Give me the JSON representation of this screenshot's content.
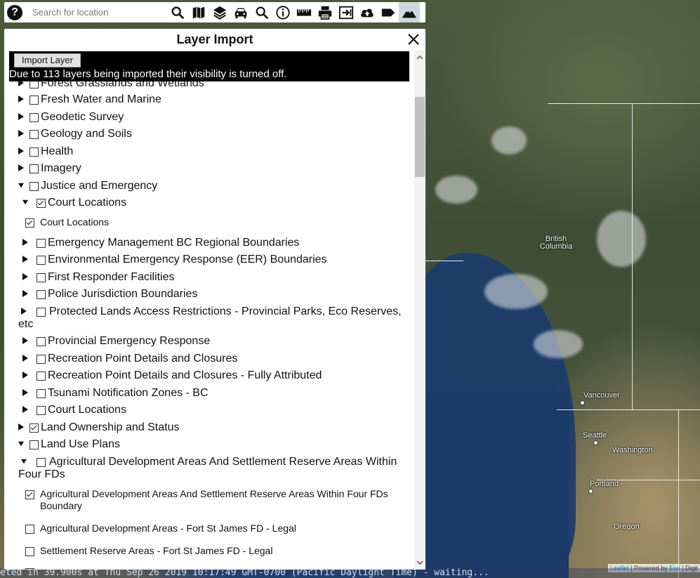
{
  "toolbar": {
    "help_symbol": "?",
    "search_placeholder": "Search for location",
    "tools": [
      "search-icon",
      "map-icon",
      "layers-icon",
      "car-icon",
      "magnifier-icon",
      "info-icon",
      "ruler-icon",
      "print-icon",
      "export-icon",
      "upload-cloud-icon",
      "tag-icon",
      "mountain-icon"
    ],
    "active_tool": "mountain-icon"
  },
  "panel": {
    "title": "Layer Import",
    "close_symbol": "✕",
    "import_button_label": "Import Layer",
    "notice": "Due to 113 layers being imported their visibility is turned off."
  },
  "layers": [
    {
      "level": 0,
      "expanded": false,
      "checked": false,
      "label": "Forest Grasslands and Wetlands"
    },
    {
      "level": 0,
      "expanded": false,
      "checked": false,
      "label": "Fresh Water and Marine"
    },
    {
      "level": 0,
      "expanded": false,
      "checked": false,
      "label": "Geodetic Survey"
    },
    {
      "level": 0,
      "expanded": false,
      "checked": false,
      "label": "Geology and Soils"
    },
    {
      "level": 0,
      "expanded": false,
      "checked": false,
      "label": "Health"
    },
    {
      "level": 0,
      "expanded": false,
      "checked": false,
      "label": "Imagery"
    },
    {
      "level": 0,
      "expanded": true,
      "checked": false,
      "label": "Justice and Emergency"
    },
    {
      "level": 1,
      "expanded": true,
      "checked": true,
      "label": "Court Locations"
    },
    {
      "level": 2,
      "checked": true,
      "label": "Court Locations"
    },
    {
      "level": 1,
      "expanded": false,
      "checked": false,
      "label": "Emergency Management BC Regional Boundaries"
    },
    {
      "level": 1,
      "expanded": false,
      "checked": false,
      "label": "Environmental Emergency Response (EER) Boundaries"
    },
    {
      "level": 1,
      "expanded": false,
      "checked": false,
      "label": "First Responder Facilities"
    },
    {
      "level": 1,
      "expanded": false,
      "checked": false,
      "label": "Police Jurisdiction Boundaries"
    },
    {
      "level": 1,
      "expanded": false,
      "checked": false,
      "label": "Protected Lands Access Restrictions - Provincial Parks, Eco Reserves, etc"
    },
    {
      "level": 1,
      "expanded": false,
      "checked": false,
      "label": "Provincial Emergency Response"
    },
    {
      "level": 1,
      "expanded": false,
      "checked": false,
      "label": "Recreation Point Details and Closures"
    },
    {
      "level": 1,
      "expanded": false,
      "checked": false,
      "label": "Recreation Point Details and Closures - Fully Attributed"
    },
    {
      "level": 1,
      "expanded": false,
      "checked": false,
      "label": "Tsunami Notification Zones - BC"
    },
    {
      "level": 1,
      "expanded": false,
      "checked": false,
      "label": "Court Locations"
    },
    {
      "level": 0,
      "expanded": false,
      "checked": true,
      "label": "Land Ownership and Status"
    },
    {
      "level": 0,
      "expanded": true,
      "checked": false,
      "label": "Land Use Plans"
    },
    {
      "level": 1,
      "expanded": true,
      "checked": false,
      "label": "Agricultural Development Areas And Settlement Reserve Areas Within Four FDs"
    },
    {
      "level": 2,
      "checked": true,
      "label": "Agricultural Development Areas And Settlement Reserve Areas Within Four FDs Boundary"
    },
    {
      "level": 2,
      "checked": false,
      "label": "Agricultural Development Areas - Fort St James FD - Legal"
    },
    {
      "level": 2,
      "checked": false,
      "label": "Settlement Reserve Areas - Fort St James FD - Legal"
    },
    {
      "level": 2,
      "checked": false,
      "label": ""
    }
  ],
  "map": {
    "places": [
      "British Columbia",
      "Vancouver",
      "Seattle",
      "Washington",
      "Portland",
      "Oregon"
    ],
    "attribution": {
      "leaflet": "Leaflet",
      "sep": " | Powered by ",
      "esri": "Esri",
      "rest": " | Digit"
    },
    "console_text": "eted in 39.900s at Thu Sep 26 2019 10:17:49 GMT-0700 (Pacific Daylight Time) - waiting..."
  }
}
